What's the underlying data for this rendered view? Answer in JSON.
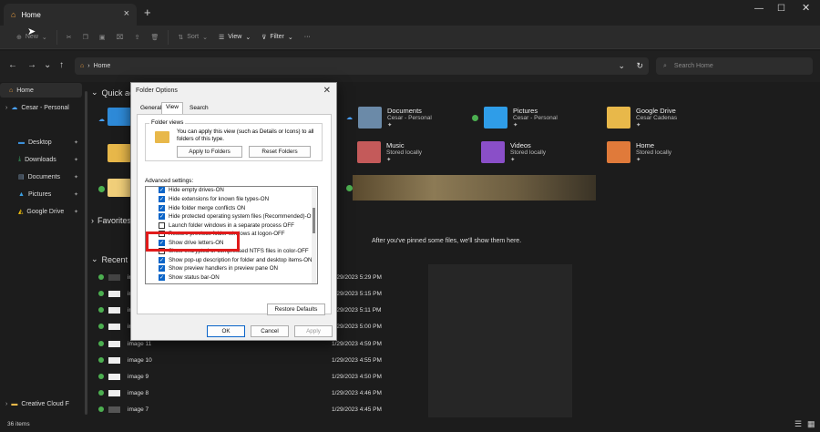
{
  "tab": {
    "title": "Home"
  },
  "toolbar": {
    "new": "New",
    "sort": "Sort",
    "view": "View",
    "filter": "Filter",
    "more": "···"
  },
  "address": {
    "location": "Home",
    "search_placeholder": "Search Home"
  },
  "sidebar": {
    "home": "Home",
    "cloud": "Cesar - Personal",
    "items": [
      {
        "label": "Desktop"
      },
      {
        "label": "Downloads"
      },
      {
        "label": "Documents"
      },
      {
        "label": "Pictures"
      },
      {
        "label": "Google Drive"
      }
    ],
    "bottom": "Creative Cloud F"
  },
  "sections": {
    "quick_access": "Quick acc",
    "favorites": "Favorites",
    "recent": "Recent"
  },
  "quick_access": [
    {
      "name": "Documents",
      "sub": "Cesar - Personal"
    },
    {
      "name": "Pictures",
      "sub": "Cesar - Personal"
    },
    {
      "name": "Google Drive",
      "sub": "Cesar Cadenas"
    },
    {
      "name": "Music",
      "sub": "Stored locally"
    },
    {
      "name": "Videos",
      "sub": "Stored locally"
    },
    {
      "name": "Home",
      "sub": "Stored locally"
    }
  ],
  "favorites_empty": "After you've pinned some files, we'll show them here.",
  "recent": [
    {
      "name": "im",
      "date": "1/29/2023 5:29 PM"
    },
    {
      "name": "im",
      "date": "1/29/2023 5:15 PM"
    },
    {
      "name": "im",
      "date": "1/29/2023 5:11 PM"
    },
    {
      "name": "im",
      "date": "1/29/2023 5:00 PM"
    },
    {
      "name": "image 11",
      "date": "1/29/2023 4:59 PM"
    },
    {
      "name": "image 10",
      "date": "1/29/2023 4:55 PM"
    },
    {
      "name": "image 9",
      "date": "1/29/2023 4:50 PM"
    },
    {
      "name": "image 8",
      "date": "1/29/2023 4:46 PM"
    },
    {
      "name": "image 7",
      "date": "1/29/2023 4:45 PM"
    }
  ],
  "status": {
    "count": "36 items"
  },
  "dialog": {
    "title": "Folder Options",
    "tabs": [
      "General",
      "View",
      "Search"
    ],
    "folder_views_label": "Folder views",
    "folder_views_text": "You can apply this view (such as Details or Icons) to all folders of this type.",
    "apply_btn": "Apply to Folders",
    "reset_btn": "Reset Folders",
    "advanced_label": "Advanced settings:",
    "settings": [
      {
        "label": "Hide empty drives-ON",
        "checked": true
      },
      {
        "label": "Hide extensions for known file types-ON",
        "checked": true
      },
      {
        "label": "Hide folder merge conflicts ON",
        "checked": true
      },
      {
        "label": "Hide protected operating system files (Recommended)-OF",
        "checked": true
      },
      {
        "label": "Launch folder windows in a separate process OFF",
        "checked": false
      },
      {
        "label": "Restore previous folder windows at logon-OFF",
        "checked": false
      },
      {
        "label": "Show drive letters-ON",
        "checked": true
      },
      {
        "label": "Show encrypted or compressed NTFS files in color-OFF",
        "checked": false
      },
      {
        "label": "Show pop-up description for folder and desktop items-ON",
        "checked": true
      },
      {
        "label": "Show preview handlers in preview pane ON",
        "checked": true
      },
      {
        "label": "Show status bar-ON",
        "checked": true
      }
    ],
    "restore_btn": "Restore Defaults",
    "ok": "OK",
    "cancel": "Cancel",
    "apply": "Apply"
  }
}
